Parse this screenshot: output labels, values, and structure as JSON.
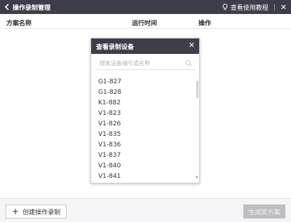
{
  "window": {
    "title": "操作录制管理",
    "tutorial_label": "查看使用教程",
    "separator": "|"
  },
  "table": {
    "columns": [
      "方案名称",
      "运行时间",
      "操作"
    ]
  },
  "footer": {
    "create_label": "创建操作录制",
    "generate_label": "生成宏方案"
  },
  "dialog": {
    "title": "查看录制设备",
    "search_placeholder": "搜索设备编号或名称",
    "devices": [
      "G1-827",
      "G1-828",
      "K1-882",
      "V1-823",
      "V1-826",
      "V1-835",
      "V1-836",
      "V1-837",
      "V1-840",
      "V1-841"
    ]
  },
  "icons": {
    "back": "chevron-left-icon",
    "tutorial": "lightbulb-icon",
    "close": "close-icon",
    "search": "search-icon",
    "add": "plus-icon"
  },
  "colors": {
    "titlebar": "#3d3e4a",
    "disabled_button": "#bdbdc2"
  }
}
